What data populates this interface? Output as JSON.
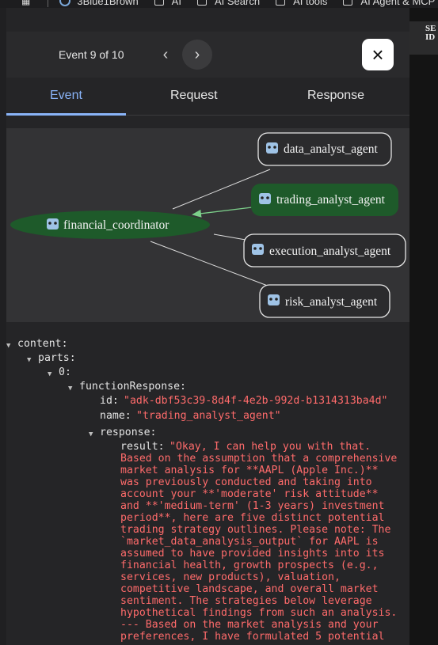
{
  "bookmarks": [
    {
      "label": "3Blue1Brown"
    },
    {
      "label": "AI"
    },
    {
      "label": "AI Search"
    },
    {
      "label": "AI tools"
    },
    {
      "label": "AI Agent & MCP"
    }
  ],
  "side_label": {
    "line1": "SE",
    "line2": "ID"
  },
  "header": {
    "event_counter": "Event 9 of 10",
    "prev_icon": "‹",
    "next_icon": "›",
    "close_icon": "×"
  },
  "tabs": [
    {
      "label": "Event",
      "active": true
    },
    {
      "label": "Request",
      "active": false
    },
    {
      "label": "Response",
      "active": false
    }
  ],
  "graph": {
    "root": {
      "label": "financial_coordinator",
      "icon": "robot-icon",
      "color": "#1e5a2a"
    },
    "agents": [
      {
        "label": "data_analyst_agent",
        "highlighted": false
      },
      {
        "label": "trading_analyst_agent",
        "highlighted": true
      },
      {
        "label": "execution_analyst_agent",
        "highlighted": false
      },
      {
        "label": "risk_analyst_agent",
        "highlighted": false
      }
    ],
    "highlight_color": "#1e5a2a",
    "arrow_color": "#7ccf8a"
  },
  "tree": {
    "content_key": "content:",
    "parts_key": "parts:",
    "index_key": "0:",
    "function_response_key": "functionResponse:",
    "id_key": "id:",
    "id_value": "\"adk-dbf53c39-8d4f-4e2b-992d-b1314313ba4d\"",
    "name_key": "name:",
    "name_value": "\"trading_analyst_agent\"",
    "response_key": "response:",
    "result_key": "result:",
    "result_first_line": "\"Okay, I can help you with that.",
    "result_lines": "Based on the assumption that a comprehensive\nmarket analysis for **AAPL (Apple Inc.)**\nwas previously conducted and taking into\naccount your **'moderate' risk attitude**\nand **'medium-term' (1-3 years) investment\nperiod**, here are five distinct potential\ntrading strategy outlines. Please note: The\n`market_data_analysis_output` for AAPL is\nassumed to have provided insights into its\nfinancial health, growth prospects (e.g.,\nservices, new products), valuation,\ncompetitive landscape, and overall market\nsentiment. The strategies below leverage\nhypothetical findings from such an analysis.\n--- Based on the market analysis and your\npreferences, I have formulated 5 potential"
  }
}
